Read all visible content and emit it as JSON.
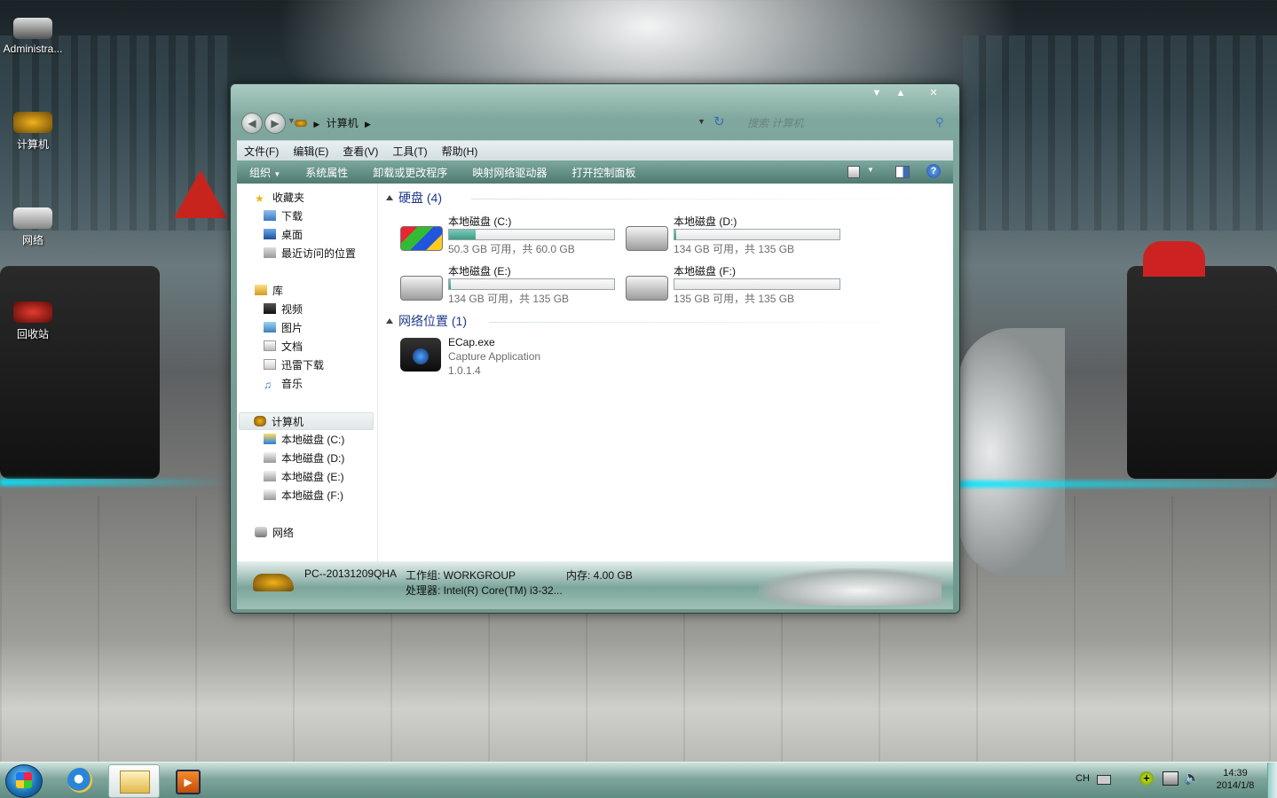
{
  "desktop": {
    "icons": [
      {
        "label": "Administra..."
      },
      {
        "label": "计算机"
      },
      {
        "label": "网络"
      },
      {
        "label": "回收站"
      }
    ]
  },
  "window": {
    "address": {
      "location": "计算机"
    },
    "search": {
      "placeholder": "搜索 计算机"
    },
    "menu": [
      "文件(F)",
      "编辑(E)",
      "查看(V)",
      "工具(T)",
      "帮助(H)"
    ],
    "commands": [
      "组织",
      "系统属性",
      "卸载或更改程序",
      "映射网络驱动器",
      "打开控制面板"
    ],
    "nav": {
      "favorites": {
        "label": "收藏夹",
        "items": [
          "下载",
          "桌面",
          "最近访问的位置"
        ]
      },
      "libraries": {
        "label": "库",
        "items": [
          "视频",
          "图片",
          "文档",
          "迅雷下载",
          "音乐"
        ]
      },
      "computer": {
        "label": "计算机",
        "items": [
          "本地磁盘 (C:)",
          "本地磁盘 (D:)",
          "本地磁盘 (E:)",
          "本地磁盘 (F:)"
        ]
      },
      "network": {
        "label": "网络"
      }
    },
    "groups": {
      "hard_disks": {
        "title": "硬盘 (4)",
        "drives": [
          {
            "name": "本地磁盘 (C:)",
            "info": "50.3 GB 可用，共 60.0 GB",
            "used_fraction": 0.16
          },
          {
            "name": "本地磁盘 (D:)",
            "info": "134 GB 可用，共 135 GB",
            "used_fraction": 0.01
          },
          {
            "name": "本地磁盘 (E:)",
            "info": "134 GB 可用，共 135 GB",
            "used_fraction": 0.01
          },
          {
            "name": "本地磁盘 (F:)",
            "info": "135 GB 可用，共 135 GB",
            "used_fraction": 0.0
          }
        ]
      },
      "network_locations": {
        "title": "网络位置 (1)",
        "items": [
          {
            "name": "ECap.exe",
            "description": "Capture Application",
            "version": "1.0.1.4"
          }
        ]
      }
    },
    "details": {
      "pc_name": "PC--20131209QHA",
      "workgroup": "工作组: WORKGROUP",
      "memory": "内存: 4.00 GB",
      "processor": "处理器: Intel(R) Core(TM) i3-32..."
    }
  },
  "taskbar": {
    "lang": "CH",
    "time": "14:39",
    "date": "2014/1/8"
  }
}
